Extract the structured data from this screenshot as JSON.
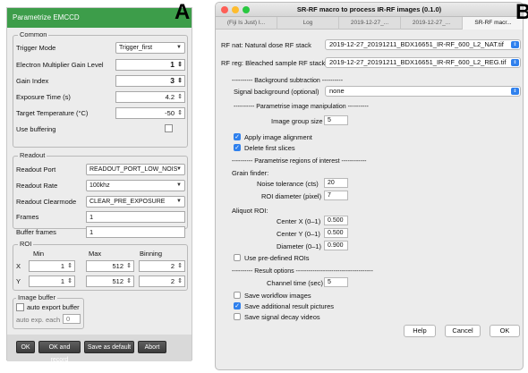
{
  "panel_a": {
    "letter": "A",
    "title": "Parametrize EMCCD",
    "common": {
      "title": "Common",
      "trigger_mode_label": "Trigger Mode",
      "trigger_mode_value": "Trigger_first",
      "em_gain_label": "Electron Multiplier Gain Level",
      "em_gain_value": "1",
      "gain_index_label": "Gain Index",
      "gain_index_value": "3",
      "exposure_label": "Exposure Time (s)",
      "exposure_value": "4.2",
      "temperature_label": "Target Temperature (°C)",
      "temperature_value": "-50",
      "buffering_label": "Use buffering"
    },
    "readout": {
      "title": "Readout",
      "port_label": "Readout Port",
      "port_value": "READOUT_PORT_LOW_NOIS",
      "rate_label": "Readout Rate",
      "rate_value": "100khz",
      "clearmode_label": "Readout Clearmode",
      "clearmode_value": "CLEAR_PRE_EXPOSURE",
      "frames_label": "Frames",
      "frames_value": "1",
      "buffer_frames_label": "Buffer frames",
      "buffer_frames_value": "1"
    },
    "roi": {
      "title": "ROI",
      "col_min": "Min",
      "col_max": "Max",
      "col_binning": "Binning",
      "x_label": "X",
      "x_min": "1",
      "x_max": "512",
      "x_bin": "2",
      "y_label": "Y",
      "y_min": "1",
      "y_max": "512",
      "y_bin": "2"
    },
    "image_buffer": {
      "title": "Image buffer",
      "auto_export_label": "auto export buffer",
      "auto_exp_each_label": "auto exp. each",
      "auto_exp_each_value": "0"
    },
    "buttons": {
      "ok": "OK",
      "ok_record": "OK and record",
      "save_default": "Save as default",
      "abort": "Abort"
    }
  },
  "panel_b": {
    "letter": "B",
    "title": "SR-RF macro to process IR-RF images (0.1.0)",
    "tabs": [
      "(Fiji Is Just) I...",
      "Log",
      "2019-12-27_...",
      "2019-12-27_...",
      "SR-RF macr..."
    ],
    "rf_nat_label": "RF nat: Natural dose RF stack",
    "rf_nat_value": "2019-12-27_20191211_BDX16651_IR-RF_600_L2_NAT.tif",
    "rf_reg_label": "RF reg: Bleached sample RF stack",
    "rf_reg_value": "2019-12-27_20191211_BDX16651_IR-RF_600_L2_REG.tif",
    "bg_section": "---------- Background subtraction ----------",
    "signal_bg_label": "Signal background (optional)",
    "signal_bg_value": "none",
    "param_section": "---------- Parametrise image manipulation ----------",
    "group_size_label": "Image group size",
    "group_size_value": "5",
    "apply_alignment_label": "Apply image alignment",
    "delete_first_label": "Delete first slices",
    "roi_section": "---------- Parametrise regions of interest ------------",
    "grain_finder_label": "Grain finder:",
    "noise_tol_label": "Noise tolerance (cts)",
    "noise_tol_value": "20",
    "roi_diam_label": "ROI diameter (pixel)",
    "roi_diam_value": "7",
    "aliquot_label": "Aliquot ROI:",
    "center_x_label": "Center X (0–1)",
    "center_x_value": "0.500",
    "center_y_label": "Center Y (0–1)",
    "center_y_value": "0.500",
    "diameter_label": "Diameter (0–1)",
    "diameter_value": "0.900",
    "predefined_label": "Use pre-defined ROIs",
    "result_section": "---------- Result options -------------------------------------",
    "channel_time_label": "Channel time (sec)",
    "channel_time_value": "5",
    "save_workflow_label": "Save workflow images",
    "save_additional_label": "Save additional result pictures",
    "save_decay_label": "Save signal decay videos",
    "btn_help": "Help",
    "btn_cancel": "Cancel",
    "btn_ok": "OK"
  },
  "colors": {
    "panel_a_titlebar": "#3d9d4a",
    "accent_blue": "#2f80ed"
  }
}
